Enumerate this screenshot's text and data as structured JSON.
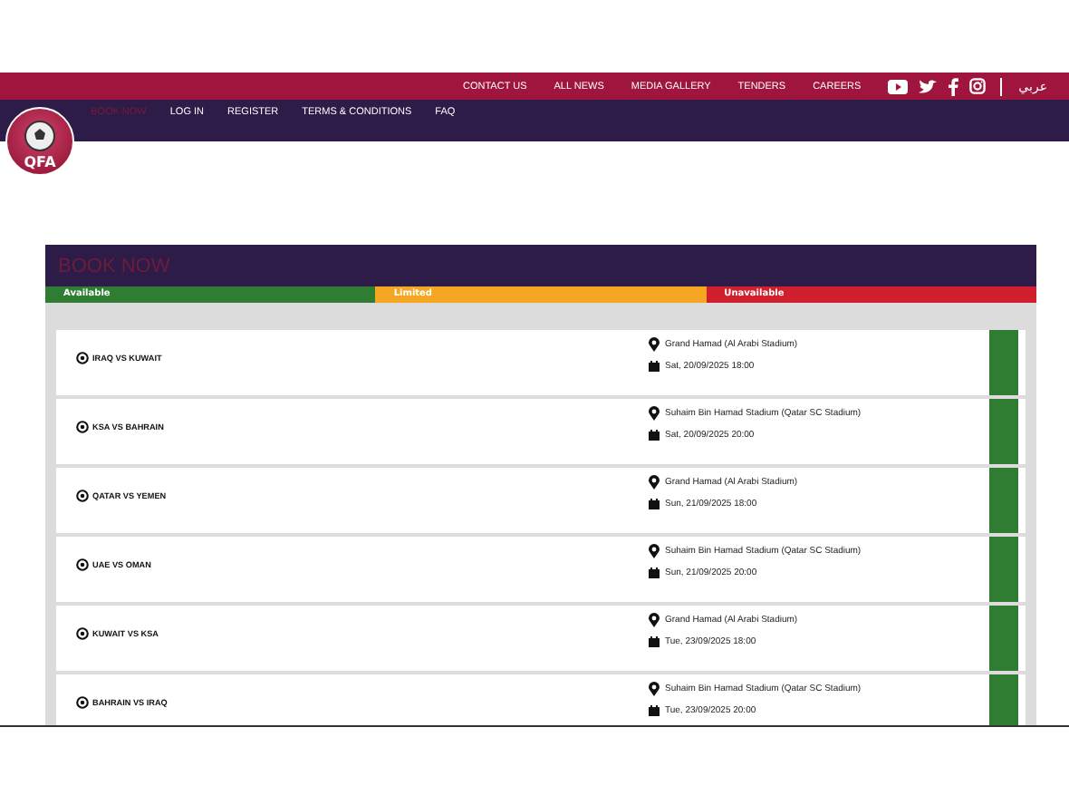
{
  "top_bar": {
    "links": [
      "CONTACT US",
      "ALL NEWS",
      "MEDIA GALLERY",
      "TENDERS",
      "CAREERS"
    ],
    "language": "عربي"
  },
  "logo": {
    "text": "QFA"
  },
  "nav": [
    {
      "label": "BOOK NOW",
      "selected": true
    },
    {
      "label": "LOG IN",
      "selected": false
    },
    {
      "label": "REGISTER",
      "selected": false
    },
    {
      "label": "TERMS & CONDITIONS",
      "selected": false
    },
    {
      "label": "FAQ",
      "selected": false
    }
  ],
  "booking": {
    "title": "BOOK NOW",
    "legend": [
      {
        "label": "Available",
        "color": "#2e7d32"
      },
      {
        "label": "Limited",
        "color": "#f5a623"
      },
      {
        "label": "Unavailable",
        "color": "#d0202e"
      }
    ],
    "matches": [
      {
        "name": "IRAQ VS KUWAIT",
        "venue": "Grand Hamad (Al Arabi Stadium)",
        "date": "Sat, 20/09/2025 18:00",
        "color": "#2e7d32"
      },
      {
        "name": "KSA VS BAHRAIN",
        "venue": "Suhaim Bin Hamad Stadium (Qatar SC Stadium)",
        "date": "Sat, 20/09/2025 20:00",
        "color": "#2e7d32"
      },
      {
        "name": "QATAR VS YEMEN",
        "venue": "Grand Hamad (Al Arabi Stadium)",
        "date": "Sun, 21/09/2025 18:00",
        "color": "#2e7d32"
      },
      {
        "name": "UAE VS OMAN",
        "venue": "Suhaim Bin Hamad Stadium (Qatar SC Stadium)",
        "date": "Sun, 21/09/2025 20:00",
        "color": "#2e7d32"
      },
      {
        "name": "KUWAIT VS KSA",
        "venue": "Grand Hamad (Al Arabi Stadium)",
        "date": "Tue, 23/09/2025 18:00",
        "color": "#2e7d32"
      },
      {
        "name": "BAHRAIN VS IRAQ",
        "venue": "Suhaim Bin Hamad Stadium (Qatar SC Stadium)",
        "date": "Tue, 23/09/2025 20:00",
        "color": "#2e7d32"
      }
    ]
  }
}
